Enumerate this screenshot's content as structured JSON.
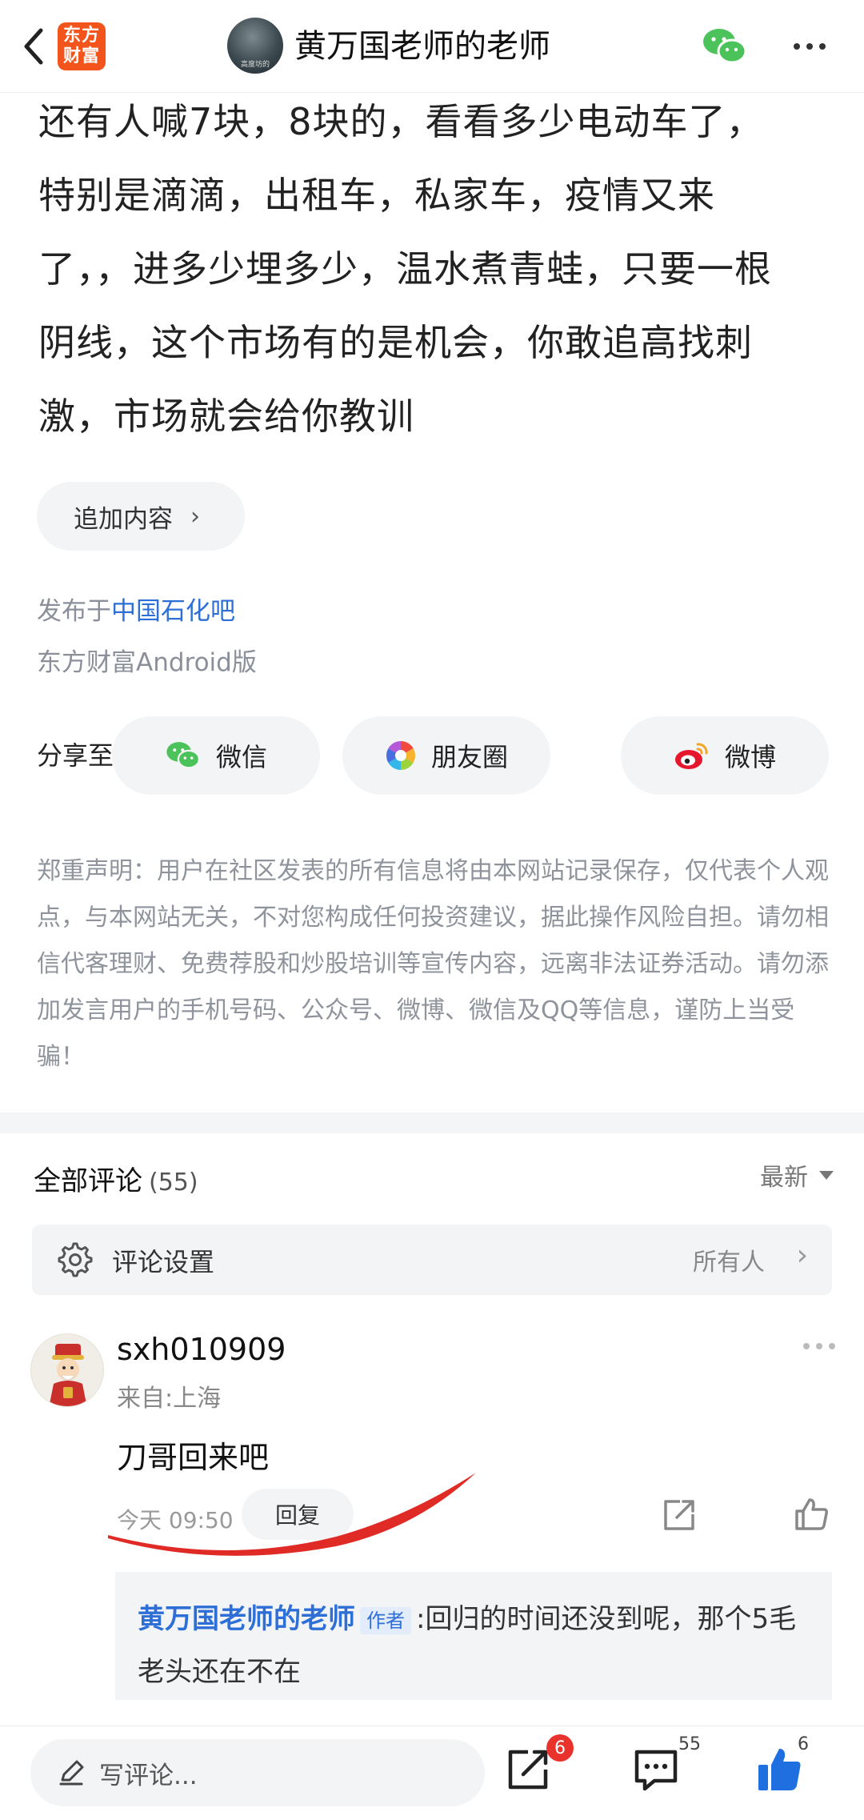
{
  "header": {
    "back_icon": "chevron-left-icon",
    "app_logo_line1": "东方",
    "app_logo_line2": "财富",
    "avatar_caption": "高度坊的",
    "title": "黄万国老师的老师",
    "wechat_icon": "wechat-icon",
    "more_icon": "more-horizontal-icon"
  },
  "post": {
    "body_lines": [
      "还有人喊7块，8块的，看看多少电动车了，",
      "特别是滴滴，出租车，私家车，疫情又来",
      "了，，进多少埋多少，温水煮青蛙，只要一根",
      "阴线，这个市场有的是机会，你敢追高找刺",
      "激，市场就会给你教训"
    ],
    "append_label": "追加内容",
    "posted_in_prefix": "发布于",
    "forum_name": "中国石化吧",
    "client": "东方财富Android版"
  },
  "share": {
    "label": "分享至:",
    "buttons": [
      {
        "label": "微信",
        "icon": "wechat-icon"
      },
      {
        "label": "朋友圈",
        "icon": "moments-icon"
      },
      {
        "label": "微博",
        "icon": "weibo-icon"
      }
    ]
  },
  "disclaimer": "郑重声明：用户在社区发表的所有信息将由本网站记录保存，仅代表个人观点，与本网站无关，不对您构成任何投资建议，据此操作风险自担。请勿相信代客理财、免费荐股和炒股培训等宣传内容，远离非法证券活动。请勿添加发言用户的手机号码、公众号、微博、微信及QQ等信息，谨防上当受骗！",
  "comments": {
    "title": "全部评论",
    "count": "(55)",
    "sort": "最新",
    "settings_label": "评论设置",
    "settings_value": "所有人",
    "items": [
      {
        "username": "sxh010909",
        "location": "来自:上海",
        "text": "刀哥回来吧",
        "time": "今天 09:50",
        "reply_label": "回复",
        "reply": {
          "author": "黄万国老师的老师",
          "badge": "作者",
          "text": ":回归的时间还没到呢，那个5毛老头还在不在"
        }
      }
    ]
  },
  "bottom_bar": {
    "write_placeholder": "写评论...",
    "share_badge": "6",
    "comment_count": "55",
    "like_count": "6"
  },
  "colors": {
    "accent_blue": "#2d6fd6",
    "brand_orange": "#f2541b",
    "badge_red": "#e8322b",
    "annotation_red": "#e02a25"
  }
}
